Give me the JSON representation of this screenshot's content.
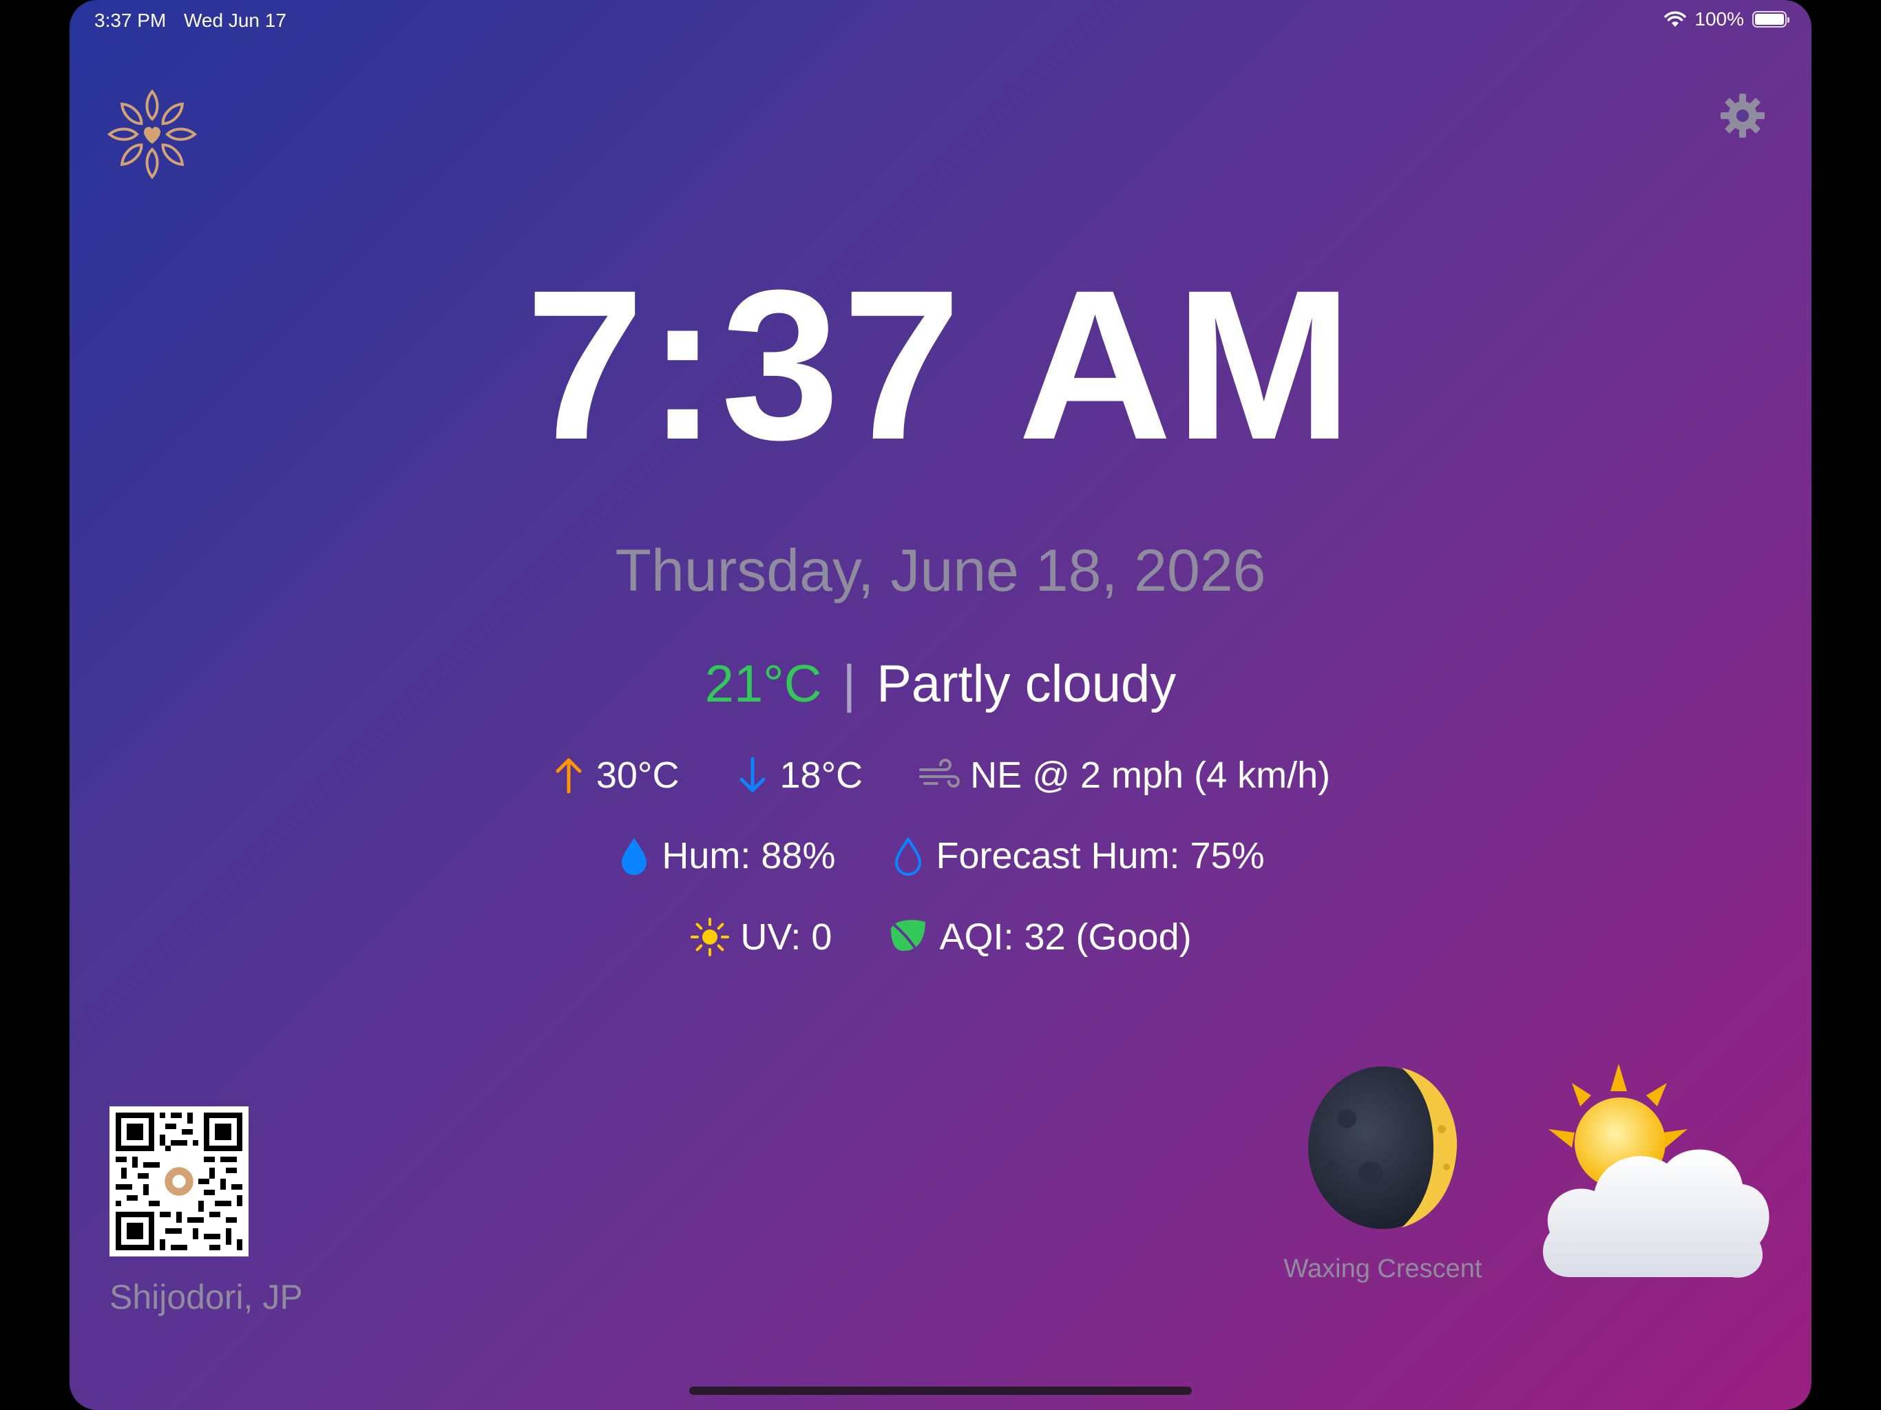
{
  "status_bar": {
    "time": "3:37 PM",
    "date": "Wed Jun 17",
    "battery": "100%",
    "battery_level": 1.0
  },
  "clock": {
    "time": "7:37 AM",
    "date": "Thursday, June 18, 2026"
  },
  "weather": {
    "current_temp": "21°C",
    "separator": "|",
    "condition": "Partly cloudy",
    "high": "30°C",
    "low": "18°C",
    "wind": "NE @ 2 mph (4 km/h)",
    "humidity": "Hum: 88%",
    "forecast_humidity": "Forecast Hum: 75%",
    "uv": "UV: 0",
    "aqi": "AQI: 32 (Good)"
  },
  "location": "Shijodori, JP",
  "moon_phase": "Waxing Crescent",
  "icons": {
    "logo": "mandala-heart-logo",
    "settings": "gear-icon",
    "high": "arrow-up-icon",
    "low": "arrow-down-icon",
    "wind": "wind-icon",
    "humidity": "water-drop-filled-icon",
    "forecast_humidity": "water-drop-outline-icon",
    "uv": "sun-icon",
    "aqi": "leaf-icon",
    "moon": "waxing-crescent-moon-icon",
    "weather": "sun-behind-cloud-icon"
  },
  "colors": {
    "temp_current": "#34c759",
    "high_arrow": "#ff9500",
    "low_arrow": "#0a84ff",
    "humidity": "#0a84ff",
    "uv": "#ffcc00",
    "aqi": "#34c759",
    "logo": "#d4a373"
  }
}
